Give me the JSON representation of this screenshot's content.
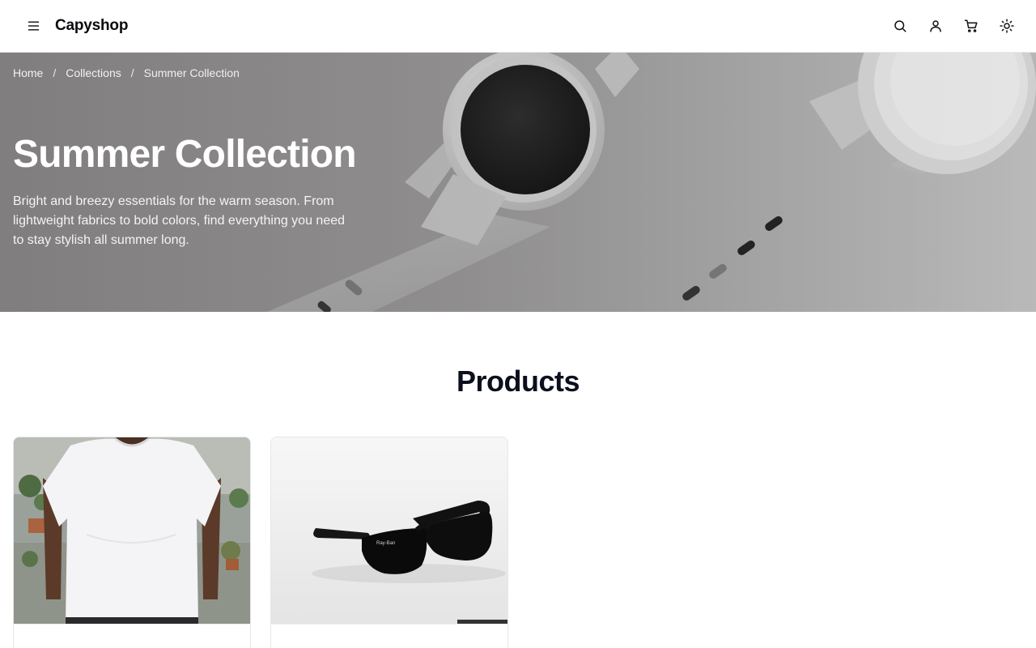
{
  "header": {
    "brand": "Capyshop",
    "icons": {
      "menu": "menu-icon",
      "search": "search-icon",
      "account": "user-icon",
      "cart": "cart-icon",
      "theme": "sun-icon"
    }
  },
  "breadcrumb": {
    "items": [
      "Home",
      "Collections",
      "Summer Collection"
    ],
    "separator": "/"
  },
  "hero": {
    "title": "Summer Collection",
    "description": "Bright and breezy essentials for the warm season. From lightweight fabrics to bold colors, find everything you need to stay stylish all summer long."
  },
  "products": {
    "heading": "Products",
    "items": [
      {
        "image": "white-tshirt-image"
      },
      {
        "image": "black-sunglasses-image"
      }
    ]
  },
  "colors": {
    "text": "#0f172a",
    "border": "#e5e7eb",
    "hero_text": "#ffffff"
  }
}
